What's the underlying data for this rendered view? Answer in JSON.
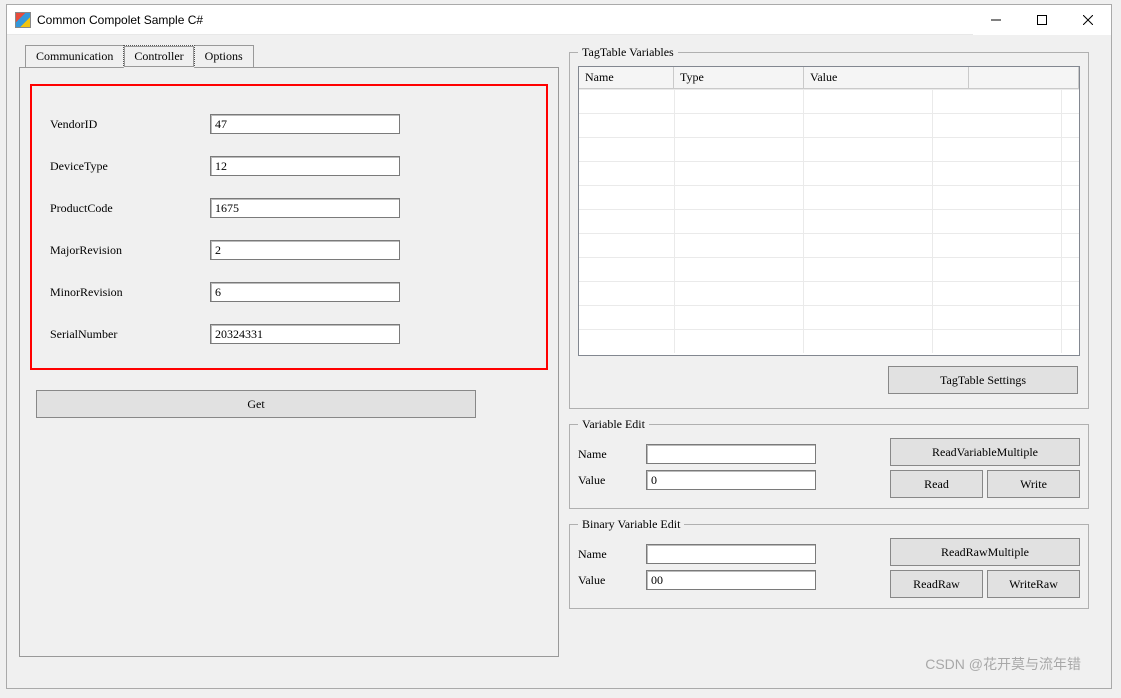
{
  "window": {
    "title": "Common Compolet Sample C#"
  },
  "tabs": {
    "communication": "Communication",
    "controller": "Controller",
    "options": "Options"
  },
  "controller": {
    "fields": {
      "vendorId": {
        "label": "VendorID",
        "value": "47"
      },
      "deviceType": {
        "label": "DeviceType",
        "value": "12"
      },
      "productCode": {
        "label": "ProductCode",
        "value": "1675"
      },
      "majorRevision": {
        "label": "MajorRevision",
        "value": "2"
      },
      "minorRevision": {
        "label": "MinorRevision",
        "value": "6"
      },
      "serialNumber": {
        "label": "SerialNumber",
        "value": "20324331"
      }
    },
    "getButton": "Get"
  },
  "tagtable": {
    "legend": "TagTable Variables",
    "columns": {
      "name": "Name",
      "type": "Type",
      "value": "Value"
    },
    "settingsButton": "TagTable Settings"
  },
  "variableEdit": {
    "legend": "Variable Edit",
    "nameLabel": "Name",
    "nameValue": "",
    "valueLabel": "Value",
    "valueValue": "0",
    "readMultiple": "ReadVariableMultiple",
    "read": "Read",
    "write": "Write"
  },
  "binaryEdit": {
    "legend": "Binary Variable Edit",
    "nameLabel": "Name",
    "nameValue": "",
    "valueLabel": "Value",
    "valueValue": "00",
    "readMultiple": "ReadRawMultiple",
    "read": "ReadRaw",
    "write": "WriteRaw"
  },
  "watermark": "CSDN @花开莫与流年错"
}
